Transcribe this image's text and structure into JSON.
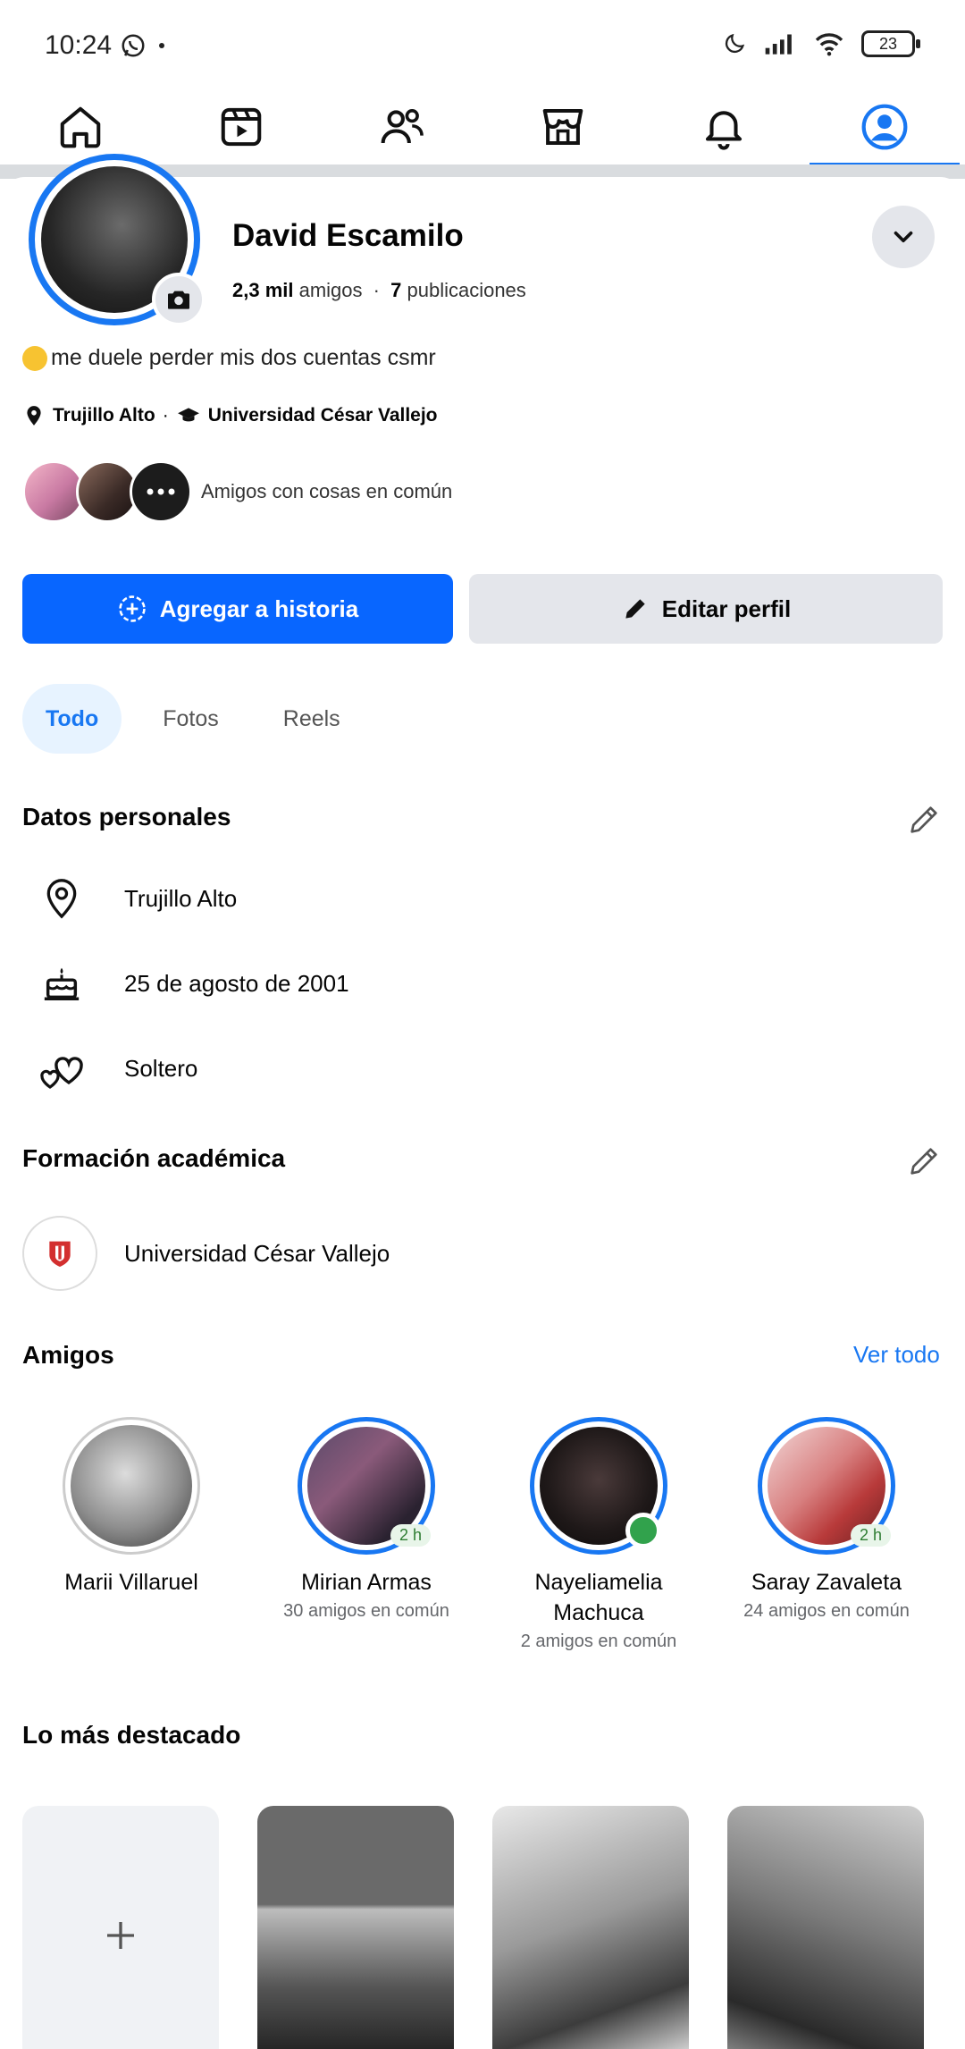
{
  "status_bar": {
    "time": "10:24",
    "battery": "23"
  },
  "nav": {
    "items": [
      "home-icon",
      "video-icon",
      "friends-icon",
      "marketplace-icon",
      "bell-icon",
      "profile-icon"
    ],
    "active": "profile-icon",
    "accent": "#1877f2"
  },
  "profile": {
    "name": "David Escamilo",
    "friends_count": "2,3 mil",
    "friends_label": "amigos",
    "separator": "·",
    "posts_count": "7",
    "posts_label": "publicaciones",
    "bio": "me duele perder mis dos cuentas csmr",
    "location": "Trujillo Alto",
    "meta_separator": "·",
    "school": "Universidad César Vallejo",
    "mutual_label": "Amigos con cosas en común"
  },
  "actions": {
    "add_story": "Agregar a historia",
    "edit_profile": "Editar perfil"
  },
  "tabs": [
    {
      "label": "Todo",
      "active": true
    },
    {
      "label": "Fotos"
    },
    {
      "label": "Reels"
    }
  ],
  "personal": {
    "title": "Datos personales",
    "rows": [
      {
        "icon": "location-icon",
        "text": "Trujillo Alto"
      },
      {
        "icon": "birthday-cake-icon",
        "text": "25 de agosto de 2001"
      },
      {
        "icon": "hearts-icon",
        "text": "Soltero"
      }
    ]
  },
  "education": {
    "title": "Formación académica",
    "school": "Universidad César Vallejo"
  },
  "friends": {
    "title": "Amigos",
    "see_all": "Ver todo",
    "list": [
      {
        "name": "Marii Villaruel",
        "mutual": ""
      },
      {
        "name": "Mirian Armas",
        "mutual": "30 amigos en común",
        "badge": "2 h"
      },
      {
        "name": "Nayeliamelia Machuca",
        "mutual": "2 amigos en común",
        "online": true
      },
      {
        "name": "Saray Zavaleta",
        "mutual": "24 amigos en común",
        "badge": "2 h"
      }
    ]
  },
  "highlights": {
    "title": "Lo más destacado",
    "add_icon": "plus-icon"
  }
}
